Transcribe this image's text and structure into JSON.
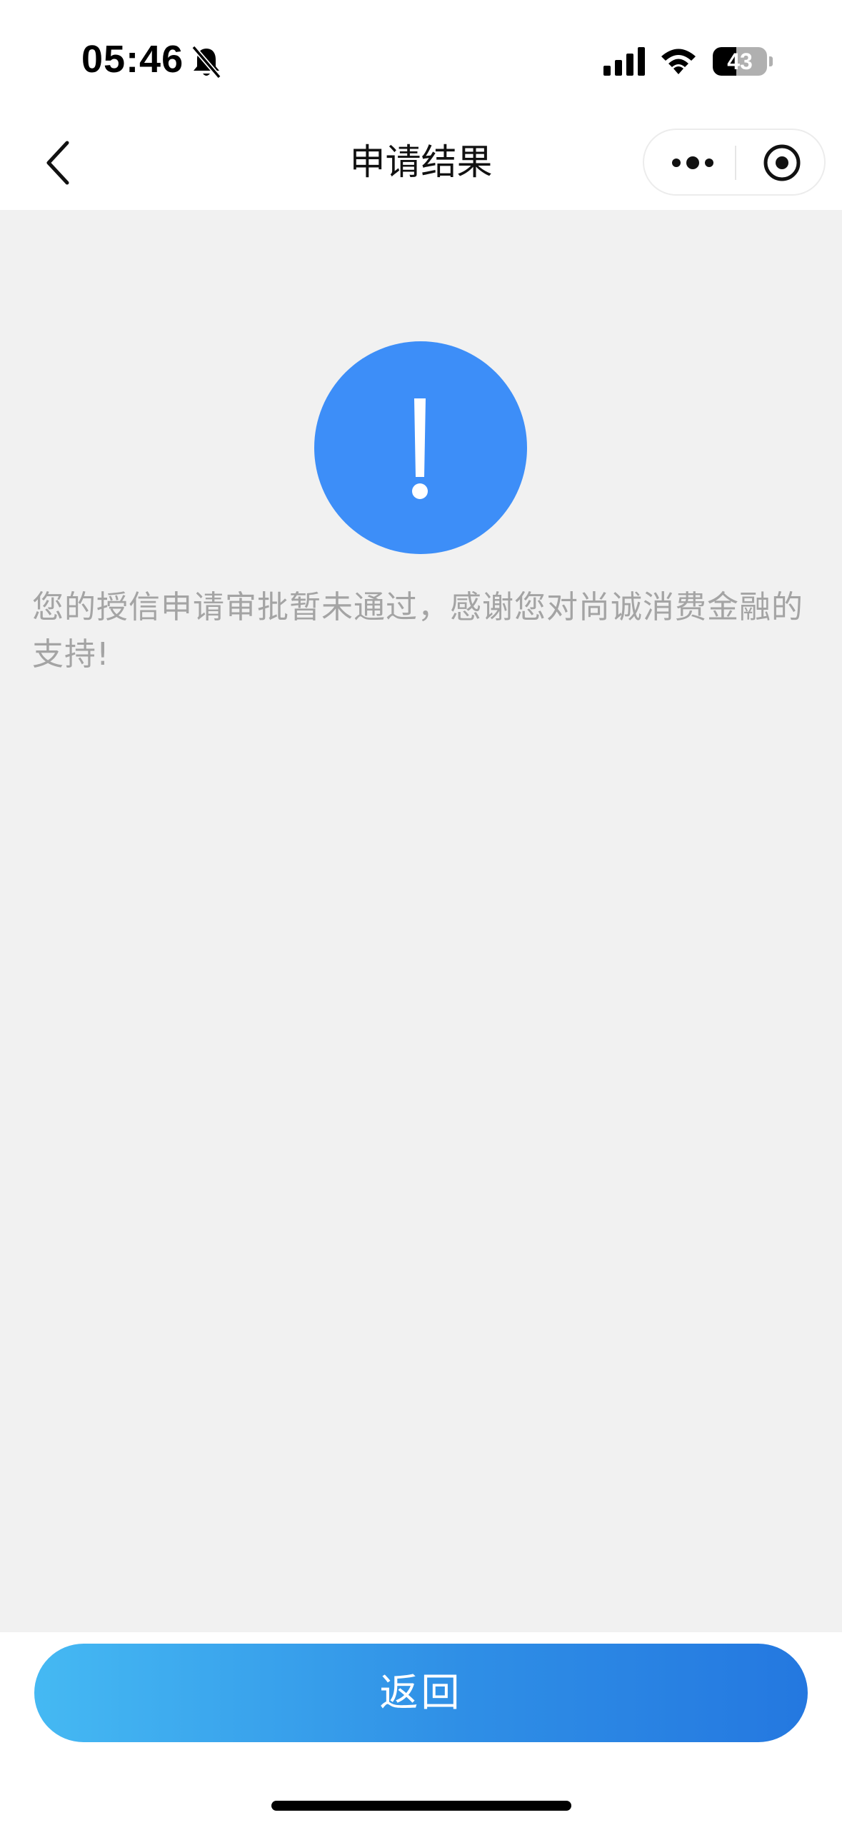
{
  "status_bar": {
    "time": "05:46",
    "battery_level": "43",
    "battery_fraction": 0.43,
    "icons": [
      "bell-muted-icon",
      "cellular-signal-icon",
      "wifi-icon",
      "battery-icon"
    ]
  },
  "nav": {
    "title": "申请结果",
    "back_icon": "chevron-left-icon",
    "more_icon": "more-dots-icon",
    "close_icon": "target-close-icon"
  },
  "result": {
    "icon": "exclamation-icon",
    "icon_color": "#3d8ef8",
    "message": "您的授信申请审批暂未通过，感谢您对尚诚消费金融的支持!"
  },
  "footer": {
    "return_label": "返回",
    "button_gradient": [
      "#45b9f3",
      "#2478e0"
    ]
  }
}
